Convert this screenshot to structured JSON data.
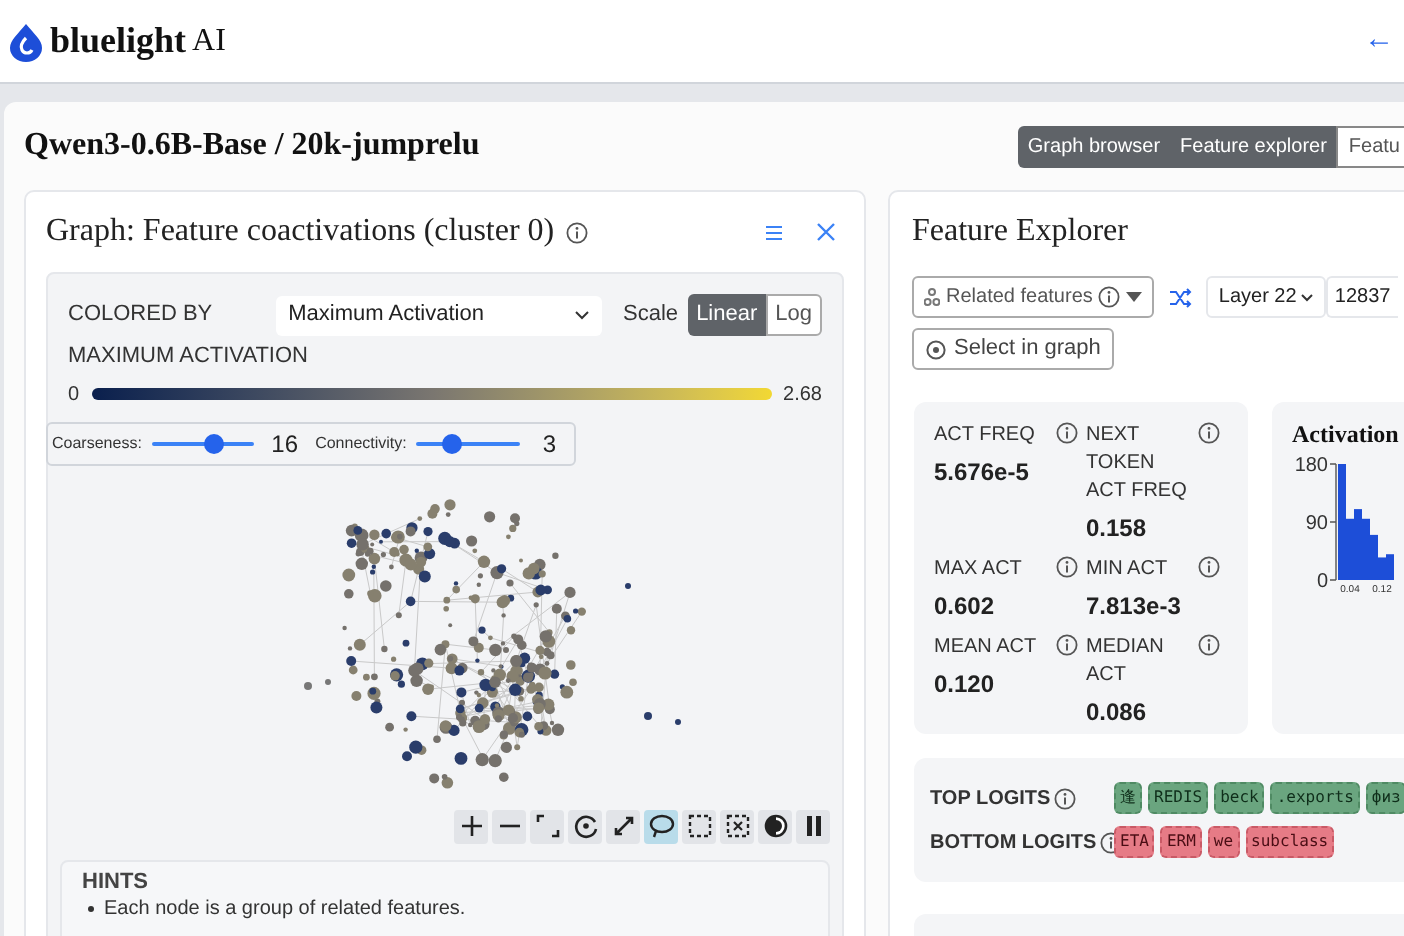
{
  "header": {
    "logo_text": "bluelight",
    "logo_suffix": "AI",
    "back_arrow": "←"
  },
  "page_title": "Qwen3-0.6B-Base / 20k-jumprelu",
  "view_tabs": [
    {
      "label": "Graph browser",
      "selected": true
    },
    {
      "label": "Feature explorer",
      "selected": true
    },
    {
      "label": "Featu",
      "selected": false
    }
  ],
  "graph_panel": {
    "title": "Graph: Feature coactivations (cluster 0)",
    "colored_by_label": "COLORED BY",
    "colored_by_value": "Maximum Activation",
    "scale_label": "Scale",
    "scale_options": [
      {
        "label": "Linear",
        "selected": true
      },
      {
        "label": "Log",
        "selected": false
      }
    ],
    "legend_title": "MAXIMUM ACTIVATION",
    "legend_min": "0",
    "legend_max": "2.68",
    "sliders": [
      {
        "label": "Coarseness:",
        "level": 0.6,
        "reading": "16"
      },
      {
        "label": "Connectivity:",
        "level": 0.35,
        "reading": "3"
      }
    ],
    "toolbar": [
      {
        "kind": "zoom-in",
        "selected": false
      },
      {
        "kind": "zoom-out",
        "selected": false
      },
      {
        "kind": "fit",
        "selected": false
      },
      {
        "kind": "reset",
        "selected": false
      },
      {
        "kind": "expand",
        "selected": false
      },
      {
        "kind": "lasso",
        "selected": true
      },
      {
        "kind": "box-select",
        "selected": false
      },
      {
        "kind": "clear-select",
        "selected": false
      },
      {
        "kind": "contrast",
        "selected": false
      },
      {
        "kind": "pause",
        "selected": false
      }
    ],
    "hints_title": "HINTS",
    "hints": [
      "Each node is a group of related features."
    ]
  },
  "explorer": {
    "title": "Feature Explorer",
    "related_label": "Related features",
    "layer": "Layer 22",
    "feature_index": "12837",
    "select_in_graph": "Select in graph",
    "stats": [
      {
        "label": "ACT FREQ",
        "value": "5.676e-5"
      },
      {
        "label": "NEXT TOKEN ACT FREQ",
        "value": "0.158"
      },
      {
        "label": "MAX ACT",
        "value": "0.602"
      },
      {
        "label": "MIN ACT",
        "value": "7.813e-3"
      },
      {
        "label": "MEAN ACT",
        "value": "0.120"
      },
      {
        "label": "MEDIAN ACT",
        "value": "0.086"
      }
    ],
    "histogram": {
      "chart_data": {
        "type": "bar",
        "title": "Activation",
        "x": [
          0.02,
          0.04,
          0.06,
          0.08,
          0.1,
          0.12,
          0.14
        ],
        "values": [
          180,
          95,
          110,
          95,
          70,
          35,
          40
        ],
        "xlim": [
          0.01,
          0.15
        ],
        "ylim": [
          0,
          180
        ],
        "yticks": [
          0,
          90,
          180
        ],
        "xticks": [
          0.04,
          0.12
        ]
      }
    },
    "logits": [
      {
        "kind": "top",
        "label": "TOP LOGITS",
        "tokens": [
          "逢",
          "REDIS",
          "beck",
          ".exports",
          "физ"
        ]
      },
      {
        "kind": "bottom",
        "label": "BOTTOM LOGITS",
        "tokens": [
          "ETA",
          "ERM",
          "we",
          "subclass"
        ]
      }
    ]
  }
}
